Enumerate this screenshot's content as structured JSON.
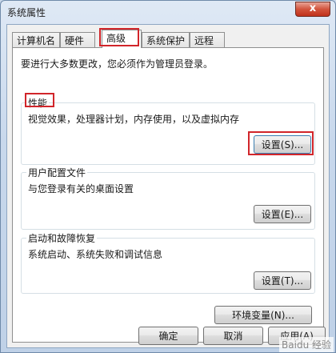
{
  "window": {
    "title": "系统属性",
    "close_glyph": "x"
  },
  "tabs": [
    {
      "label": "计算机名",
      "active": false
    },
    {
      "label": "硬件",
      "active": false
    },
    {
      "label": "高级",
      "active": true
    },
    {
      "label": "系统保护",
      "active": false
    },
    {
      "label": "远程",
      "active": false
    }
  ],
  "advanced": {
    "notice": "要进行大多数更改，您必须作为管理员登录。",
    "performance": {
      "title": "性能",
      "description": "视觉效果，处理器计划，内存使用，以及虚拟内存",
      "settings_button": "设置(S)..."
    },
    "user_profiles": {
      "title": "用户配置文件",
      "description": "与您登录有关的桌面设置",
      "settings_button": "设置(E)..."
    },
    "startup_recovery": {
      "title": "启动和故障恢复",
      "description": "系统启动、系统失败和调试信息",
      "settings_button": "设置(T)..."
    },
    "env_button": "环境变量(N)..."
  },
  "footer": {
    "ok": "确定",
    "cancel": "取消",
    "apply": "应用(A)"
  },
  "watermark": "Baidu 经验",
  "colors": {
    "highlight_box": "#d1252a",
    "window_frame": "#c8d8ec"
  }
}
